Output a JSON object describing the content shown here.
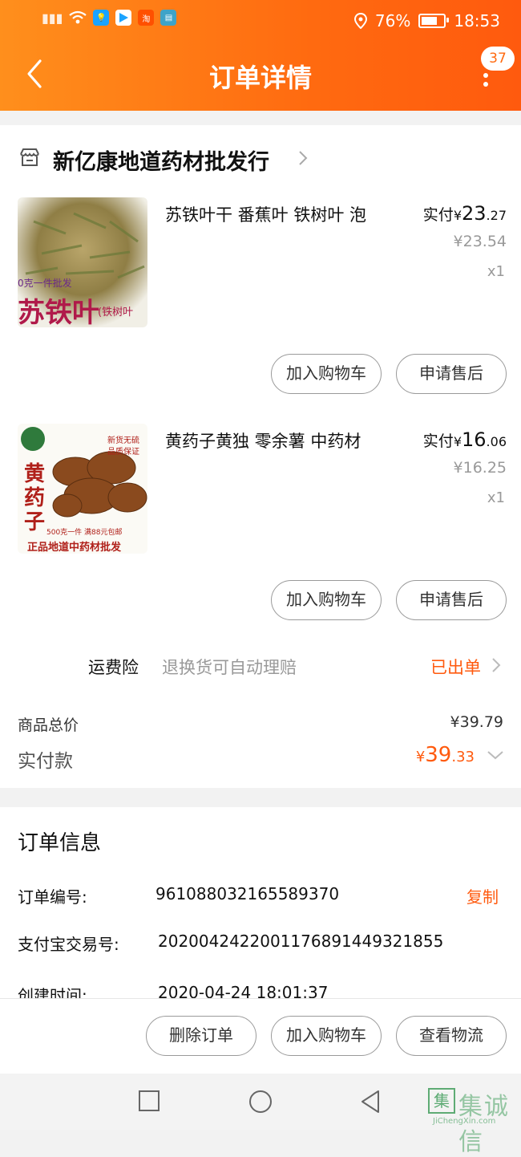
{
  "status_bar": {
    "location_icon": "location-pin-icon",
    "battery_percent": "76%",
    "time": "18:53"
  },
  "header": {
    "title": "订单详情",
    "badge_count": "37"
  },
  "shop": {
    "name": "新亿康地道药材批发行"
  },
  "items": [
    {
      "title": "苏铁叶干 番蕉叶 铁树叶 泡",
      "real_label": "实付",
      "real_currency": "¥",
      "real_int": "23",
      "real_dec": ".27",
      "orig_price": "¥23.54",
      "qty": "x1",
      "img_text_a": "0克一件批发",
      "img_text_b": "苏铁叶",
      "img_text_c": "(铁树叶",
      "btn_cart": "加入购物车",
      "btn_after": "申请售后"
    },
    {
      "title": "黄药子黄独 零余薯 中药材",
      "real_label": "实付",
      "real_currency": "¥",
      "real_int": "16",
      "real_dec": ".06",
      "orig_price": "¥16.25",
      "qty": "x1",
      "img_text_a": "黄",
      "img_text_b": "药",
      "img_text_c": "子",
      "img_text_d": "新货无硫",
      "img_text_e": "品质保证",
      "img_text_f": "500克一件 满88元包邮",
      "img_text_g": "正品地道中药材批发",
      "btn_cart": "加入购物车",
      "btn_after": "申请售后"
    }
  ],
  "insurance": {
    "label": "运费险",
    "desc": "退换货可自动理赔",
    "status": "已出单"
  },
  "totals": {
    "goods_label": "商品总价",
    "goods_value": "¥39.79",
    "paid_label": "实付款",
    "paid_currency": "¥",
    "paid_int": "39",
    "paid_dec": ".33"
  },
  "order_info": {
    "title": "订单信息",
    "order_no_label": "订单编号:",
    "order_no": "961088032165589370",
    "copy": "复制",
    "alipay_label": "支付宝交易号:",
    "alipay_no": "2020042422001176891449321855",
    "created_label": "创建时间:",
    "created_value": "2020-04-24 18:01:37"
  },
  "bottom_actions": {
    "delete": "删除订单",
    "add_cart": "加入购物车",
    "logistics": "查看物流"
  },
  "watermark": {
    "main": "集诚信",
    "sub": "JiChengXin.com"
  },
  "colors": {
    "brand": "#ff6a10",
    "price_orange": "#ff5a0e"
  }
}
